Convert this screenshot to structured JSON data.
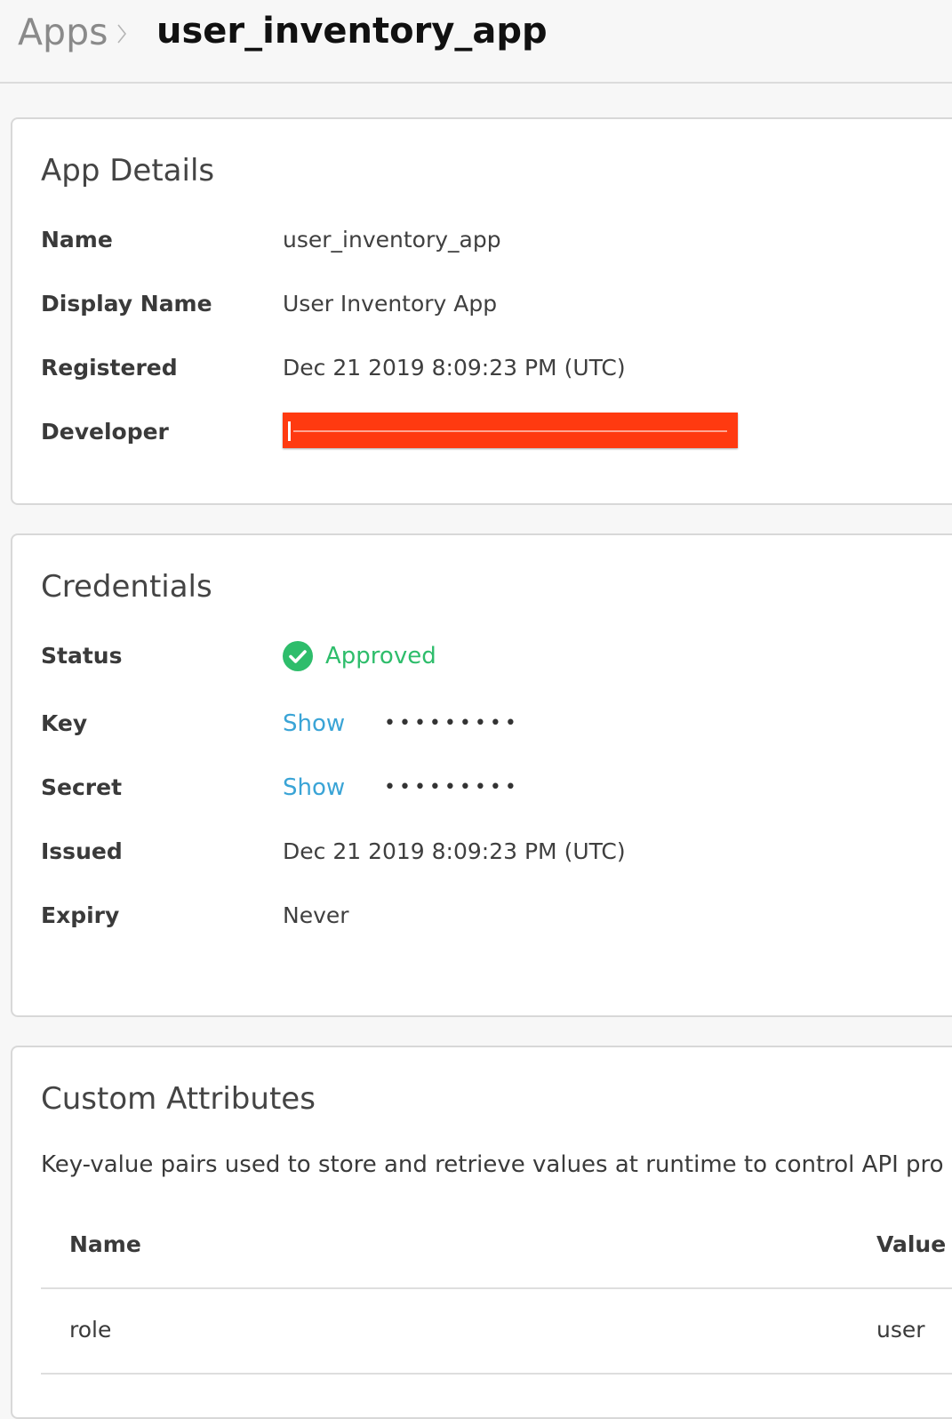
{
  "breadcrumb": {
    "root": "Apps",
    "current": "user_inventory_app"
  },
  "app_details": {
    "title": "App Details",
    "rows": [
      {
        "label": "Name",
        "value": "user_inventory_app"
      },
      {
        "label": "Display Name",
        "value": "User Inventory App"
      },
      {
        "label": "Registered",
        "value": "Dec 21 2019 8:09:23 PM (UTC)"
      },
      {
        "label": "Developer",
        "value": ""
      }
    ]
  },
  "credentials": {
    "title": "Credentials",
    "status_label": "Status",
    "status_value": "Approved",
    "key_label": "Key",
    "key_show": "Show",
    "key_masked": "•••••••••",
    "secret_label": "Secret",
    "secret_show": "Show",
    "secret_masked": "•••••••••",
    "issued_label": "Issued",
    "issued_value": "Dec 21 2019 8:09:23 PM (UTC)",
    "expiry_label": "Expiry",
    "expiry_value": "Never"
  },
  "custom_attributes": {
    "title": "Custom Attributes",
    "description": "Key-value pairs used to store and retrieve values at runtime to control API pro",
    "columns": [
      "Name",
      "Value"
    ],
    "rows": [
      {
        "name": "role",
        "value": "user"
      }
    ]
  },
  "colors": {
    "approved": "#2ebd6b",
    "link": "#3aa4d6",
    "redaction": "#ff3a10"
  },
  "icons": {
    "breadcrumb_separator": "chevron-right-icon",
    "status": "check-circle-icon"
  }
}
